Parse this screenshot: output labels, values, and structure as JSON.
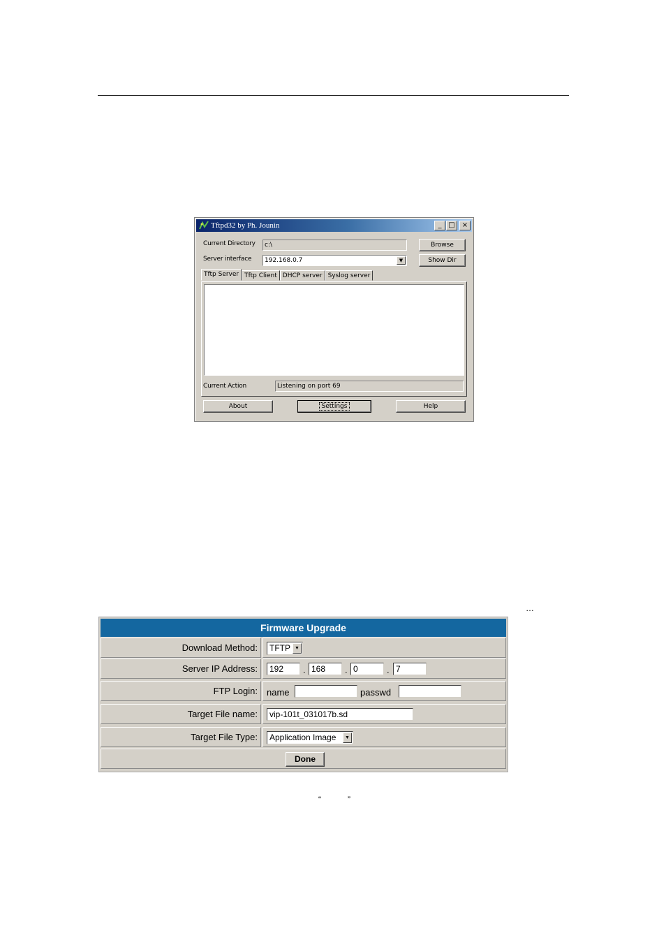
{
  "tftpd": {
    "title": "Tftpd32 by Ph. Jounin",
    "window_buttons": {
      "minimize": "_",
      "maximize": "□",
      "close": "×"
    },
    "current_directory_label": "Current Directory",
    "current_directory_value": "c:\\",
    "browse_button": "Browse",
    "server_interface_label": "Server interface",
    "server_interface_value": "192.168.0.7",
    "show_dir_button": "Show Dir",
    "tabs": [
      "Tftp Server",
      "Tftp Client",
      "DHCP server",
      "Syslog server"
    ],
    "current_action_label": "Current Action",
    "current_action_value": "Listening on port 69",
    "about_button": "About",
    "settings_button": "Settings",
    "help_button": "Help"
  },
  "ellipsis": "…",
  "firmware": {
    "header": "Firmware Upgrade",
    "download_method_label": "Download Method:",
    "download_method_value": "TFTP",
    "server_ip_label": "Server IP Address:",
    "ip_octets": [
      "192",
      "168",
      "0",
      "7"
    ],
    "ip_separator": ".",
    "ftp_login_label": "FTP Login:",
    "name_label": "name",
    "passwd_label": "passwd",
    "name_value": "",
    "passwd_value": "",
    "target_file_name_label": "Target File name:",
    "target_file_name_value": "vip-101t_031017b.sd",
    "target_file_type_label": "Target File Type:",
    "target_file_type_value": "Application Image",
    "done_button": "Done"
  },
  "quote_open": "“",
  "quote_close": "”"
}
